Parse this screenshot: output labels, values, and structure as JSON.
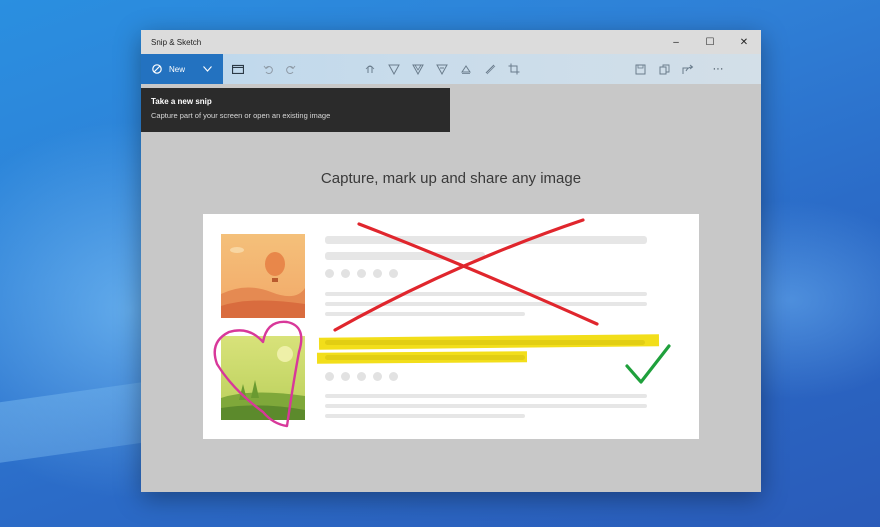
{
  "window": {
    "title": "Snip & Sketch",
    "minimize_glyph": "–",
    "maximize_glyph": "☐",
    "close_glyph": "✕"
  },
  "toolbar": {
    "new_label": "New",
    "more_glyph": "···"
  },
  "tooltip": {
    "title": "Take a new snip",
    "description": "Capture part of your screen or open an existing image"
  },
  "canvas": {
    "headline": "Capture, mark up and share any image"
  },
  "colors": {
    "accent": "#2372c0",
    "red_pen": "#e0262d",
    "highlighter": "#f2de1a",
    "pink_pen": "#d8389a",
    "green_check": "#1fa03c"
  },
  "icons": [
    "snip-icon",
    "chevron-down-icon",
    "folder-icon",
    "undo-icon",
    "redo-icon",
    "touch-writing-icon",
    "ballpoint-pen-icon",
    "pencil-icon",
    "highlighter-icon",
    "eraser-icon",
    "ruler-icon",
    "crop-icon",
    "save-icon",
    "copy-icon",
    "share-icon",
    "more-icon"
  ]
}
